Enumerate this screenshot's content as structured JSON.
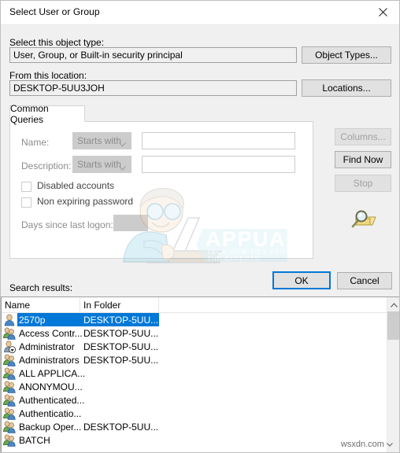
{
  "window": {
    "title": "Select User or Group",
    "close_icon": "close-icon"
  },
  "object_type": {
    "label": "Select this object type:",
    "value": "User, Group, or Built-in security principal",
    "button": "Object Types..."
  },
  "location": {
    "label": "From this location:",
    "value": "DESKTOP-5UU3JOH",
    "button": "Locations..."
  },
  "tabs": [
    {
      "label": "Common Queries"
    }
  ],
  "query": {
    "name_label": "Name:",
    "name_operator": "Starts with",
    "name_value": "",
    "description_label": "Description:",
    "description_operator": "Starts with",
    "description_value": "",
    "disabled_accounts_label": "Disabled accounts",
    "disabled_accounts_checked": false,
    "non_expiring_password_label": "Non expiring password",
    "non_expiring_password_checked": false,
    "days_since_logon_label": "Days since last logon:",
    "days_since_logon_value": ""
  },
  "side_buttons": {
    "columns": "Columns...",
    "find_now": "Find Now",
    "stop": "Stop",
    "magnifier_icon": "magnifier-folder-icon"
  },
  "dialog_buttons": {
    "ok": "OK",
    "cancel": "Cancel"
  },
  "results": {
    "label": "Search results:",
    "columns": [
      "Name",
      "In Folder"
    ],
    "rows": [
      {
        "icon": "user-icon",
        "name": "2570p",
        "folder": "DESKTOP-5UU...",
        "selected": true
      },
      {
        "icon": "group-icon",
        "name": "Access Contr...",
        "folder": "DESKTOP-5UU...",
        "selected": false
      },
      {
        "icon": "admin-icon",
        "name": "Administrator",
        "folder": "DESKTOP-5UU...",
        "selected": false
      },
      {
        "icon": "group-icon",
        "name": "Administrators",
        "folder": "DESKTOP-5UU...",
        "selected": false
      },
      {
        "icon": "group-icon",
        "name": "ALL APPLICA...",
        "folder": "",
        "selected": false
      },
      {
        "icon": "group-icon",
        "name": "ANONYMOU...",
        "folder": "",
        "selected": false
      },
      {
        "icon": "group-icon",
        "name": "Authenticated...",
        "folder": "",
        "selected": false
      },
      {
        "icon": "group-icon",
        "name": "Authenticatio...",
        "folder": "",
        "selected": false
      },
      {
        "icon": "group-icon",
        "name": "Backup Oper...",
        "folder": "DESKTOP-5UU...",
        "selected": false
      },
      {
        "icon": "group-icon",
        "name": "BATCH",
        "folder": "",
        "selected": false
      }
    ],
    "scroll_up_icon": "chevron-up-icon"
  },
  "watermarks": {
    "appuals_title": "APPUALS",
    "appuals_tagline_1": "TECH HOW-TO'S FROM",
    "appuals_tagline_2": "THE EXPERTS!",
    "site": "wsxdn.com"
  },
  "colors": {
    "accent": "#0078d7",
    "dialog_bg": "#f0f0f0",
    "field_bg": "#f0f0f0",
    "disabled_text": "#8c8c8c",
    "combo_bg": "#cccccc"
  }
}
